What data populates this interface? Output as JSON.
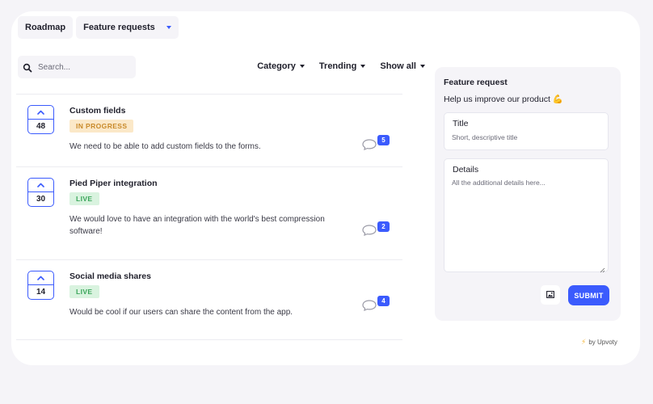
{
  "nav": {
    "roadmap_label": "Roadmap",
    "feature_requests_label": "Feature requests"
  },
  "search": {
    "placeholder": "Search..."
  },
  "filters": {
    "category_label": "Category",
    "trending_label": "Trending",
    "showall_label": "Show all"
  },
  "items": [
    {
      "title": "Custom fields",
      "votes": "48",
      "status": "IN PROGRESS",
      "description": "We need to be able to add custom fields to the forms.",
      "comments": "5"
    },
    {
      "title": "Pied Piper integration",
      "votes": "30",
      "status": "LIVE",
      "description": "We would love to have an integration with the world's best compression software!",
      "comments": "2"
    },
    {
      "title": "Social media shares",
      "votes": "14",
      "status": "LIVE",
      "description": "Would be cool if our users can share the content from the app.",
      "comments": "4"
    }
  ],
  "panel": {
    "title": "Feature request",
    "subtitle": "Help us improve our product 💪",
    "title_label": "Title",
    "title_placeholder": "Short, descriptive title",
    "details_label": "Details",
    "details_placeholder": "All the additional details here...",
    "submit_label": "SUBMIT"
  },
  "footer": {
    "powered_by": "by Upvoty"
  },
  "colors": {
    "accent": "#3b5bfd",
    "in_progress_bg": "#fbe8c8",
    "in_progress_text": "#c98a2a",
    "live_bg": "#d9f3df",
    "live_text": "#3aa55a"
  }
}
